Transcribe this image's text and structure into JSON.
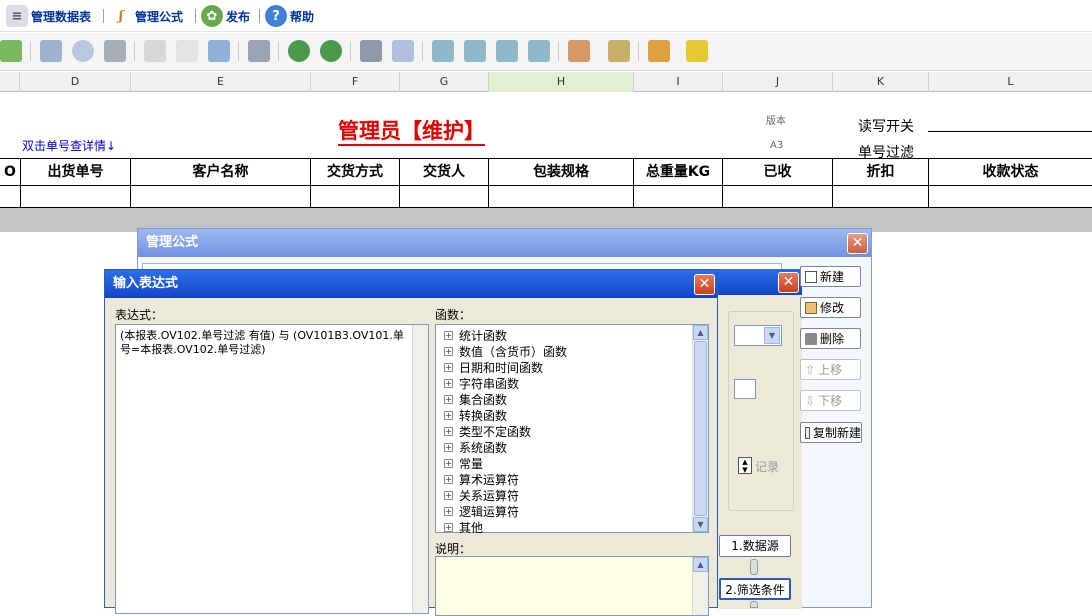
{
  "menubar": {
    "items": [
      {
        "label": "管理数据表"
      },
      {
        "label": "管理公式"
      },
      {
        "label": "发布"
      },
      {
        "label": "帮助"
      }
    ]
  },
  "columns": {
    "letters": [
      "D",
      "E",
      "F",
      "G",
      "H",
      "I",
      "J",
      "K",
      "L"
    ]
  },
  "sheet": {
    "title": "管理员【维护】",
    "hint": "双击单号查详情↓",
    "version_label": "版本",
    "version_value": "A3",
    "rw_label": "读写开关",
    "filter_label": "单号过滤",
    "headers": [
      "O",
      "出货单号",
      "客户名称",
      "交货方式",
      "交货人",
      "包装规格",
      "总重量KG",
      "已收",
      "折扣",
      "收款状态"
    ]
  },
  "manage_dialog": {
    "title": "管理公式",
    "close": "✕",
    "inner_close": "✕",
    "buttons": {
      "new": "新建",
      "edit": "修改",
      "delete": "删除",
      "up": "上移",
      "down": "下移",
      "copy_new": "复制新建"
    },
    "record_suffix": "记录",
    "step1": "1.数据源",
    "step2": "2.筛选条件"
  },
  "expr_dialog": {
    "title": "输入表达式",
    "close": "✕",
    "expr_label": "表达式：",
    "expr_line1": "(本报表.OV102.单号过滤 有值) 与 (OV101B3.OV101.单",
    "expr_line2": "号=本报表.OV102.单号过滤)",
    "func_label": "函数：",
    "functions": [
      "统计函数",
      "数值（含货币）函数",
      "日期和时间函数",
      "字符串函数",
      "集合函数",
      "转换函数",
      "类型不定函数",
      "系统函数",
      "常量",
      "算术运算符",
      "关系运算符",
      "逻辑运算符",
      "其他"
    ],
    "desc_label": "说明："
  },
  "colors": {
    "title_red": "#e00000",
    "hint_blue": "#0000cc",
    "titlebar_blue": "#1f55d0"
  }
}
